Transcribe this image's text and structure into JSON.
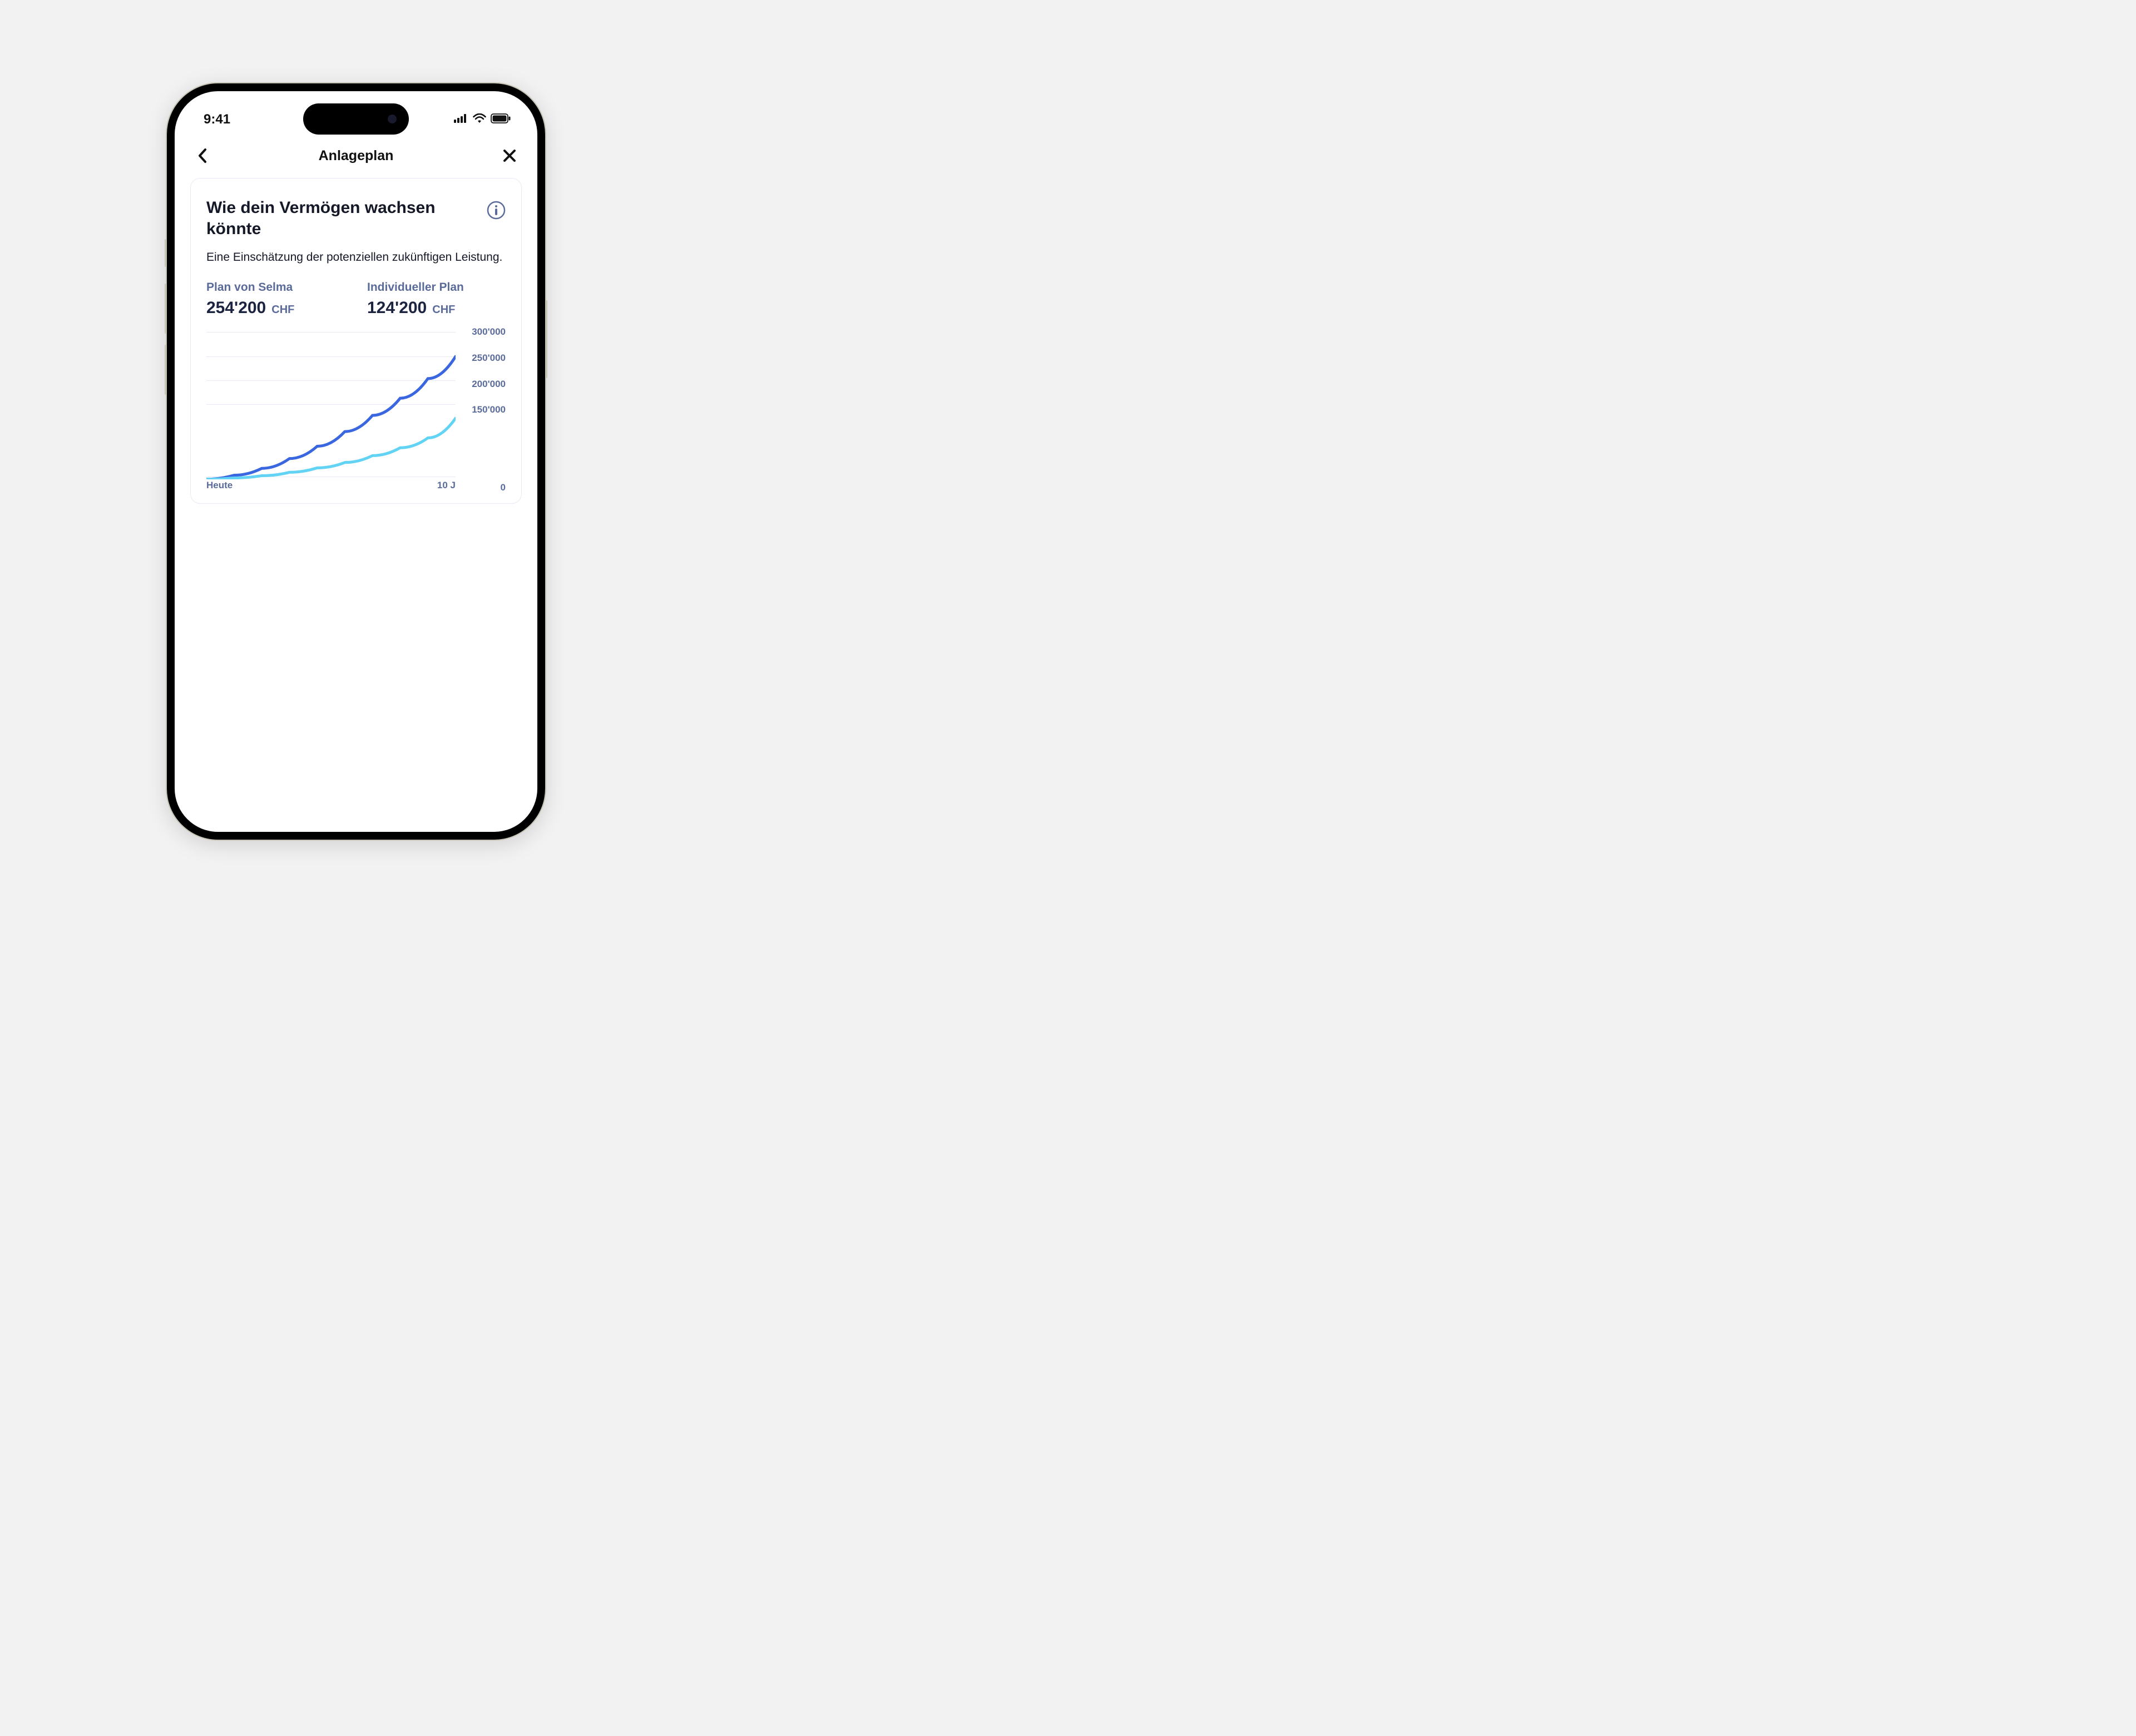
{
  "status": {
    "time": "9:41"
  },
  "nav": {
    "title": "Anlageplan"
  },
  "card": {
    "title": "Wie dein Vermögen wachsen könnte",
    "subtitle": "Eine Einschätzung der potenziellen zukünftigen Leistung.",
    "plans": [
      {
        "label": "Plan von Selma",
        "amount": "254'200",
        "currency": "CHF"
      },
      {
        "label": "Individueller Plan",
        "amount": "124'200",
        "currency": "CHF"
      }
    ]
  },
  "chart_data": {
    "type": "line",
    "title": "Wie dein Vermögen wachsen könnte",
    "xlabel": "",
    "ylabel": "",
    "ylim": [
      0,
      300000
    ],
    "x_categories": [
      "Heute",
      "10 J"
    ],
    "y_ticks": [
      "300'000",
      "250'000",
      "200'000",
      "150'000",
      "0"
    ],
    "series": [
      {
        "name": "Plan von Selma",
        "color": "#3a66e0",
        "values": [
          0,
          8000,
          22000,
          42000,
          67000,
          97000,
          130000,
          165000,
          205000,
          250000
        ]
      },
      {
        "name": "Individueller Plan",
        "color": "#62d3f5",
        "values": [
          0,
          2500,
          7000,
          14000,
          23000,
          34000,
          48000,
          64000,
          84000,
          124200
        ]
      }
    ]
  }
}
